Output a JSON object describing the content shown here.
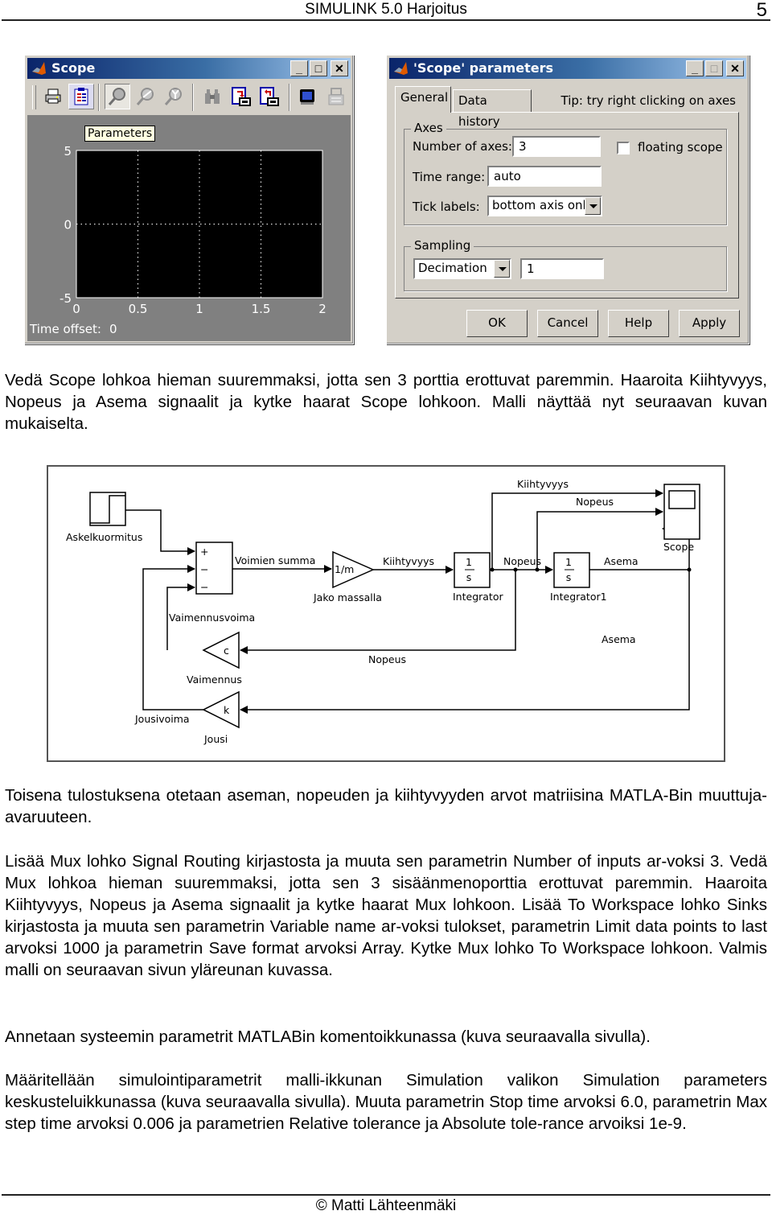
{
  "header": {
    "title": "SIMULINK 5.0 Harjoitus",
    "page_number": "5"
  },
  "scope_window": {
    "title": "Scope",
    "toolbar": [
      {
        "icon": "print-icon",
        "label": "Print"
      },
      {
        "icon": "parameters-icon",
        "label": "Parameters"
      },
      {
        "icon": "zoom-icon",
        "label": "Zoom"
      },
      {
        "icon": "zoom-x-icon",
        "label": "Zoom X-axis"
      },
      {
        "icon": "zoom-y-icon",
        "label": "Zoom Y-axis"
      },
      {
        "icon": "autoscale-icon",
        "label": "Autoscale"
      },
      {
        "icon": "save-axes-icon",
        "label": "Save axes settings"
      },
      {
        "icon": "restore-axes-icon",
        "label": "Restore axes settings"
      },
      {
        "icon": "floating-scope-icon",
        "label": "Floating scope"
      },
      {
        "icon": "signal-selection-icon",
        "label": "Signal selection"
      }
    ],
    "tooltip": "Parameters",
    "plot": {
      "y_ticks": [
        "5",
        "0",
        "-5"
      ],
      "x_ticks": [
        "0",
        "0.5",
        "1",
        "1.5",
        "2"
      ],
      "ylim": [
        -5,
        5
      ],
      "xlim": [
        0,
        2
      ]
    },
    "time_offset_label": "Time offset:",
    "time_offset_value": "0"
  },
  "params_dialog": {
    "title": "'Scope' parameters",
    "tabs": [
      {
        "label": "General",
        "active": true
      },
      {
        "label": "Data history",
        "active": false
      }
    ],
    "tip": "Tip: try right clicking on axes",
    "axes_group": "Axes",
    "number_of_axes_label": "Number of axes:",
    "number_of_axes_value": "3",
    "floating_scope_label": "floating scope",
    "floating_scope_checked": false,
    "time_range_label": "Time range:",
    "time_range_value": "auto",
    "tick_labels_label": "Tick labels:",
    "tick_labels_value": "bottom axis only",
    "sampling_group": "Sampling",
    "sampling_mode": "Decimation",
    "sampling_value": "1",
    "buttons": {
      "ok": "OK",
      "cancel": "Cancel",
      "help": "Help",
      "apply": "Apply"
    }
  },
  "paragraphs": {
    "p1": "Vedä Scope lohkoa hieman suuremmaksi, jotta sen 3 porttia erottuvat paremmin. Haaroita Kiihtyvyys, Nopeus ja Asema signaalit ja kytke haarat Scope lohkoon. Malli näyttää nyt seuraavan kuvan mukaiselta.",
    "p2": "Toisena tulostuksena otetaan aseman, nopeuden ja kiihtyvyyden arvot matriisina MATLA-Bin muuttuja-avaruuteen.",
    "p3": "Lisää Mux lohko Signal Routing kirjastosta ja muuta sen parametrin Number of inputs ar-voksi 3. Vedä Mux lohkoa hieman suuremmaksi, jotta sen 3 sisäänmenoporttia erottuvat paremmin. Haaroita Kiihtyvyys, Nopeus ja Asema signaalit ja kytke haarat Mux lohkoon. Lisää To Workspace lohko Sinks kirjastosta ja muuta sen parametrin Variable name ar-voksi tulokset, parametrin Limit data points to last arvoksi 1000 ja parametrin Save format arvoksi Array. Kytke Mux lohko To Workspace lohkoon. Valmis malli on seuraavan sivun yläreunan kuvassa.",
    "p4": "Annetaan systeemin parametrit MATLABin komentoikkunassa (kuva seuraavalla sivulla).",
    "p5": "Määritellään simulointiparametrit malli-ikkunan Simulation valikon Simulation parameters keskusteluikkunassa (kuva seuraavalla sivulla). Muuta parametrin Stop time arvoksi 6.0, parametrin Max step time arvoksi 0.006 ja parametrien Relative tolerance ja Absolute tole-rance arvoiksi 1e-9."
  },
  "diagram": {
    "blocks": {
      "step": "Askelkuormitus",
      "sum": "Voimien summa",
      "sum_signs": [
        "+",
        "−",
        "−"
      ],
      "gain_mass_text": "1/m",
      "gain_mass_label": "Jako massalla",
      "integrator_num": "1",
      "integrator_den": "s",
      "integrator_label": "Integrator",
      "integrator1_label": "Integrator1",
      "scope_label": "Scope",
      "damping_text": "c",
      "damping_label": "Vaimennus",
      "spring_text": "k",
      "spring_label": "Jousi"
    },
    "signals": {
      "acceleration": "Kiihtyvyys",
      "velocity": "Nopeus",
      "position": "Asema",
      "damping_force": "Vaimennusvoima",
      "spring_force": "Jousivoima"
    }
  },
  "footer": {
    "text": "© Matti Lähteenmäki"
  }
}
